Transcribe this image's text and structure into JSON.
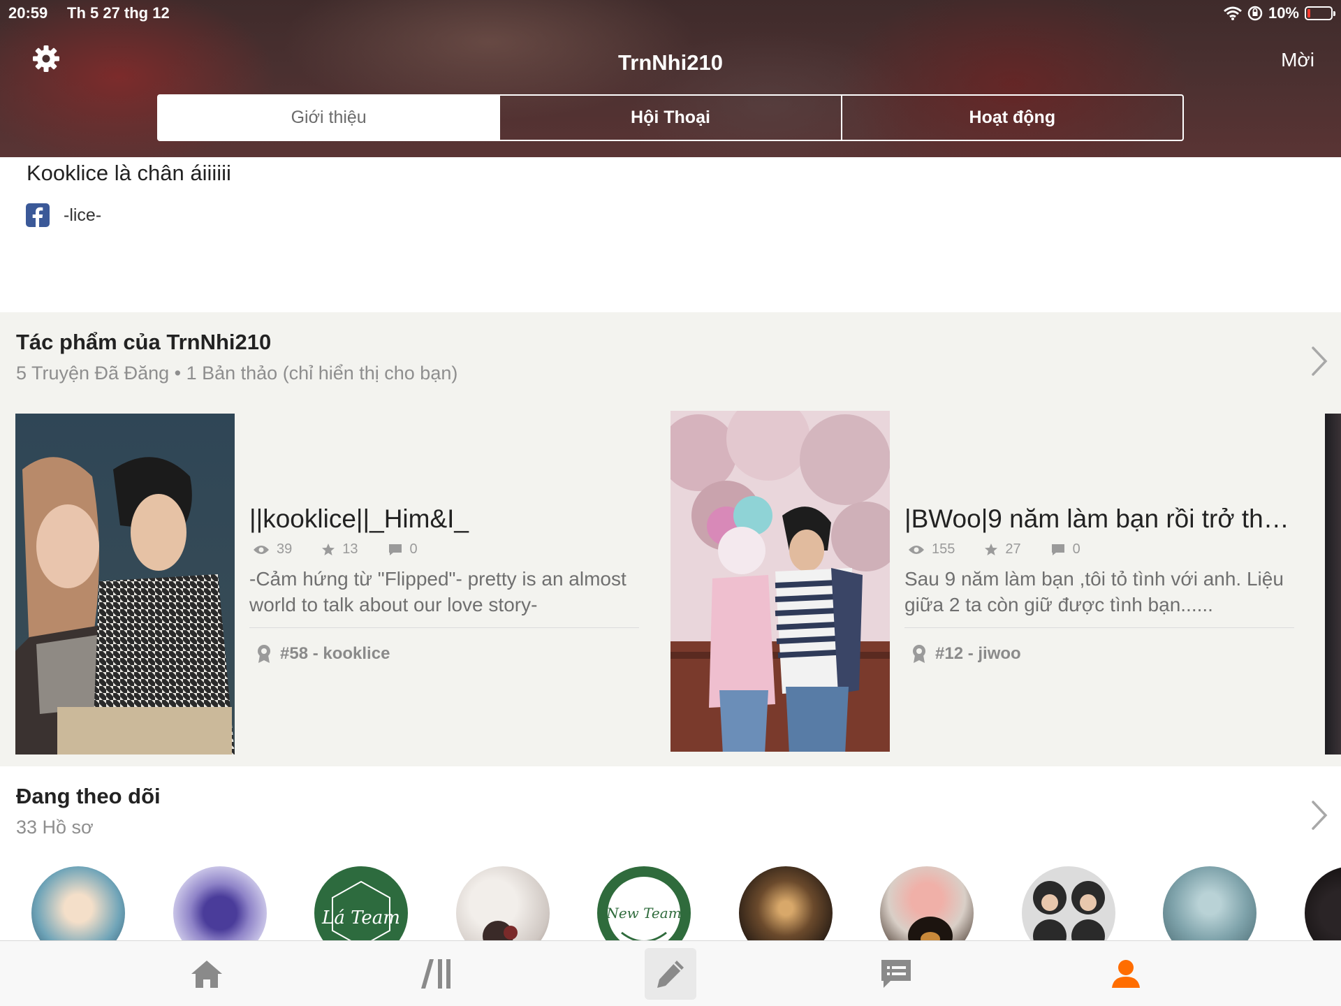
{
  "status_bar": {
    "time": "20:59",
    "date": "Th 5 27 thg 12",
    "battery": "10%"
  },
  "header": {
    "title": "TrnNhi210",
    "invite_label": "Mời"
  },
  "tabs": [
    {
      "label": "Giới thiệu",
      "active": true
    },
    {
      "label": "Hội Thoại",
      "active": false
    },
    {
      "label": "Hoạt động",
      "active": false
    }
  ],
  "about": {
    "bio": "Kooklice là chân áiiiiii",
    "facebook_name": "-lice-"
  },
  "works": {
    "title": "Tác phẩm của TrnNhi210",
    "subtitle": "5 Truyện Đã Đăng • 1 Bản thảo (chỉ hiển thị cho bạn)",
    "stories": [
      {
        "title": "||kooklice||_Him&I_",
        "views": "39",
        "votes": "13",
        "comments": "0",
        "description": "-Cảm hứng từ \"Flipped\"- pretty is an almost world to talk about our love story-",
        "rank": "#58 - kooklice"
      },
      {
        "title": "|BWoo|9 năm làm bạn rồi trở thà...",
        "views": "155",
        "votes": "27",
        "comments": "0",
        "description": "Sau 9 năm làm bạn ,tôi tỏ tình với anh. Liệu giữa 2 ta còn giữ được tình bạn......",
        "rank": "#12 - jiwoo"
      }
    ]
  },
  "following": {
    "title": "Đang theo dõi",
    "subtitle": "33 Hồ sơ"
  },
  "nav": {
    "active": "profile"
  },
  "colors": {
    "accent": "#ff6d00",
    "icon_gray": "#8a8a8a",
    "facebook": "#3b5998",
    "section_bg": "#f3f3ef"
  }
}
